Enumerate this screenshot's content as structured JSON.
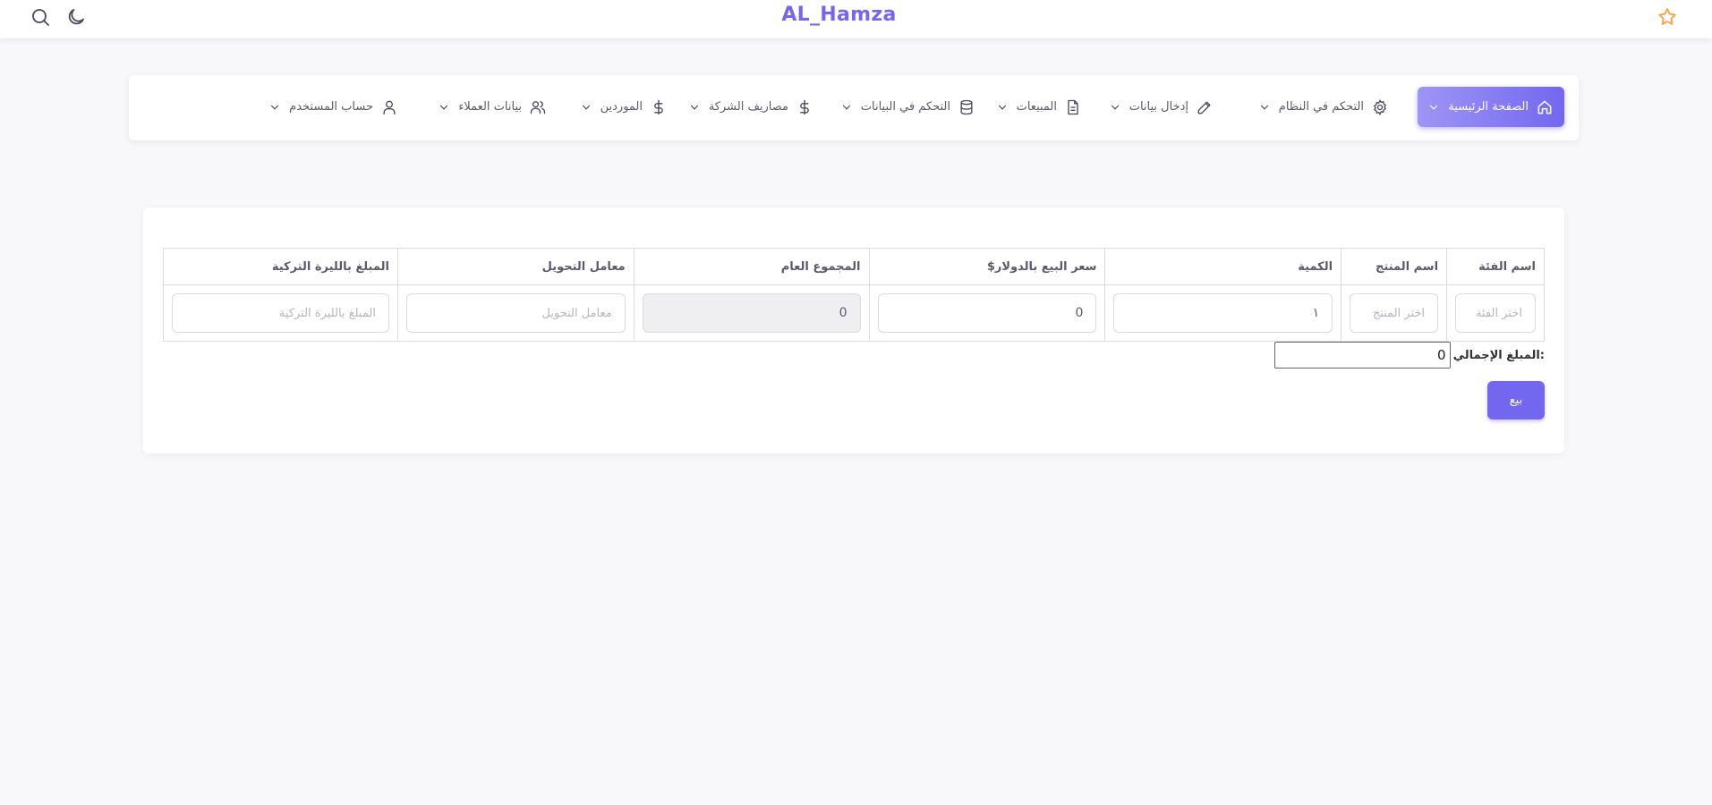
{
  "app": {
    "brand": "AL_Hamza",
    "accent_color": "#7367f0",
    "icons": {
      "search": "search-icon",
      "theme": "moon-icon",
      "favorite": "star-icon"
    }
  },
  "nav": {
    "items": [
      {
        "label": "الصفحة الرئيسية",
        "icon": "home-icon",
        "active": true
      },
      {
        "label": "التحكم في النظام",
        "icon": "gear-icon"
      },
      {
        "label": "إدخال بيانات",
        "icon": "pencil-icon"
      },
      {
        "label": "المبيعات",
        "icon": "document-icon"
      },
      {
        "label": "التحكم في البيانات",
        "icon": "database-icon"
      },
      {
        "label": "مصاريف الشركة",
        "icon": "dollar-icon"
      },
      {
        "label": "الموردين",
        "icon": "dollar-icon"
      },
      {
        "label": "بيانات العملاء",
        "icon": "users-icon"
      },
      {
        "label": "حساب المستخدم",
        "icon": "user-icon"
      }
    ]
  },
  "sale_table": {
    "headers": {
      "category": "اسم الفئة",
      "product": "اسم المنتج",
      "quantity": "الكمية",
      "price_usd": "سعر البيع بالدولار$",
      "total": "المجموع العام",
      "rate": "معامل التحويل",
      "amount_try": "المبلغ بالليرة التركية"
    },
    "row": {
      "category_placeholder": "اختر الفئة",
      "product_placeholder": "اختر المنتج",
      "quantity_value": "١",
      "price_value": "0",
      "total_value": "0",
      "rate_placeholder": "معامل التحويل",
      "amount_placeholder": "المبلغ بالليرة التركية"
    }
  },
  "summary": {
    "total_label": "المبلغ الإجمالي:",
    "total_value": "0"
  },
  "actions": {
    "sell_label": "بيع"
  }
}
